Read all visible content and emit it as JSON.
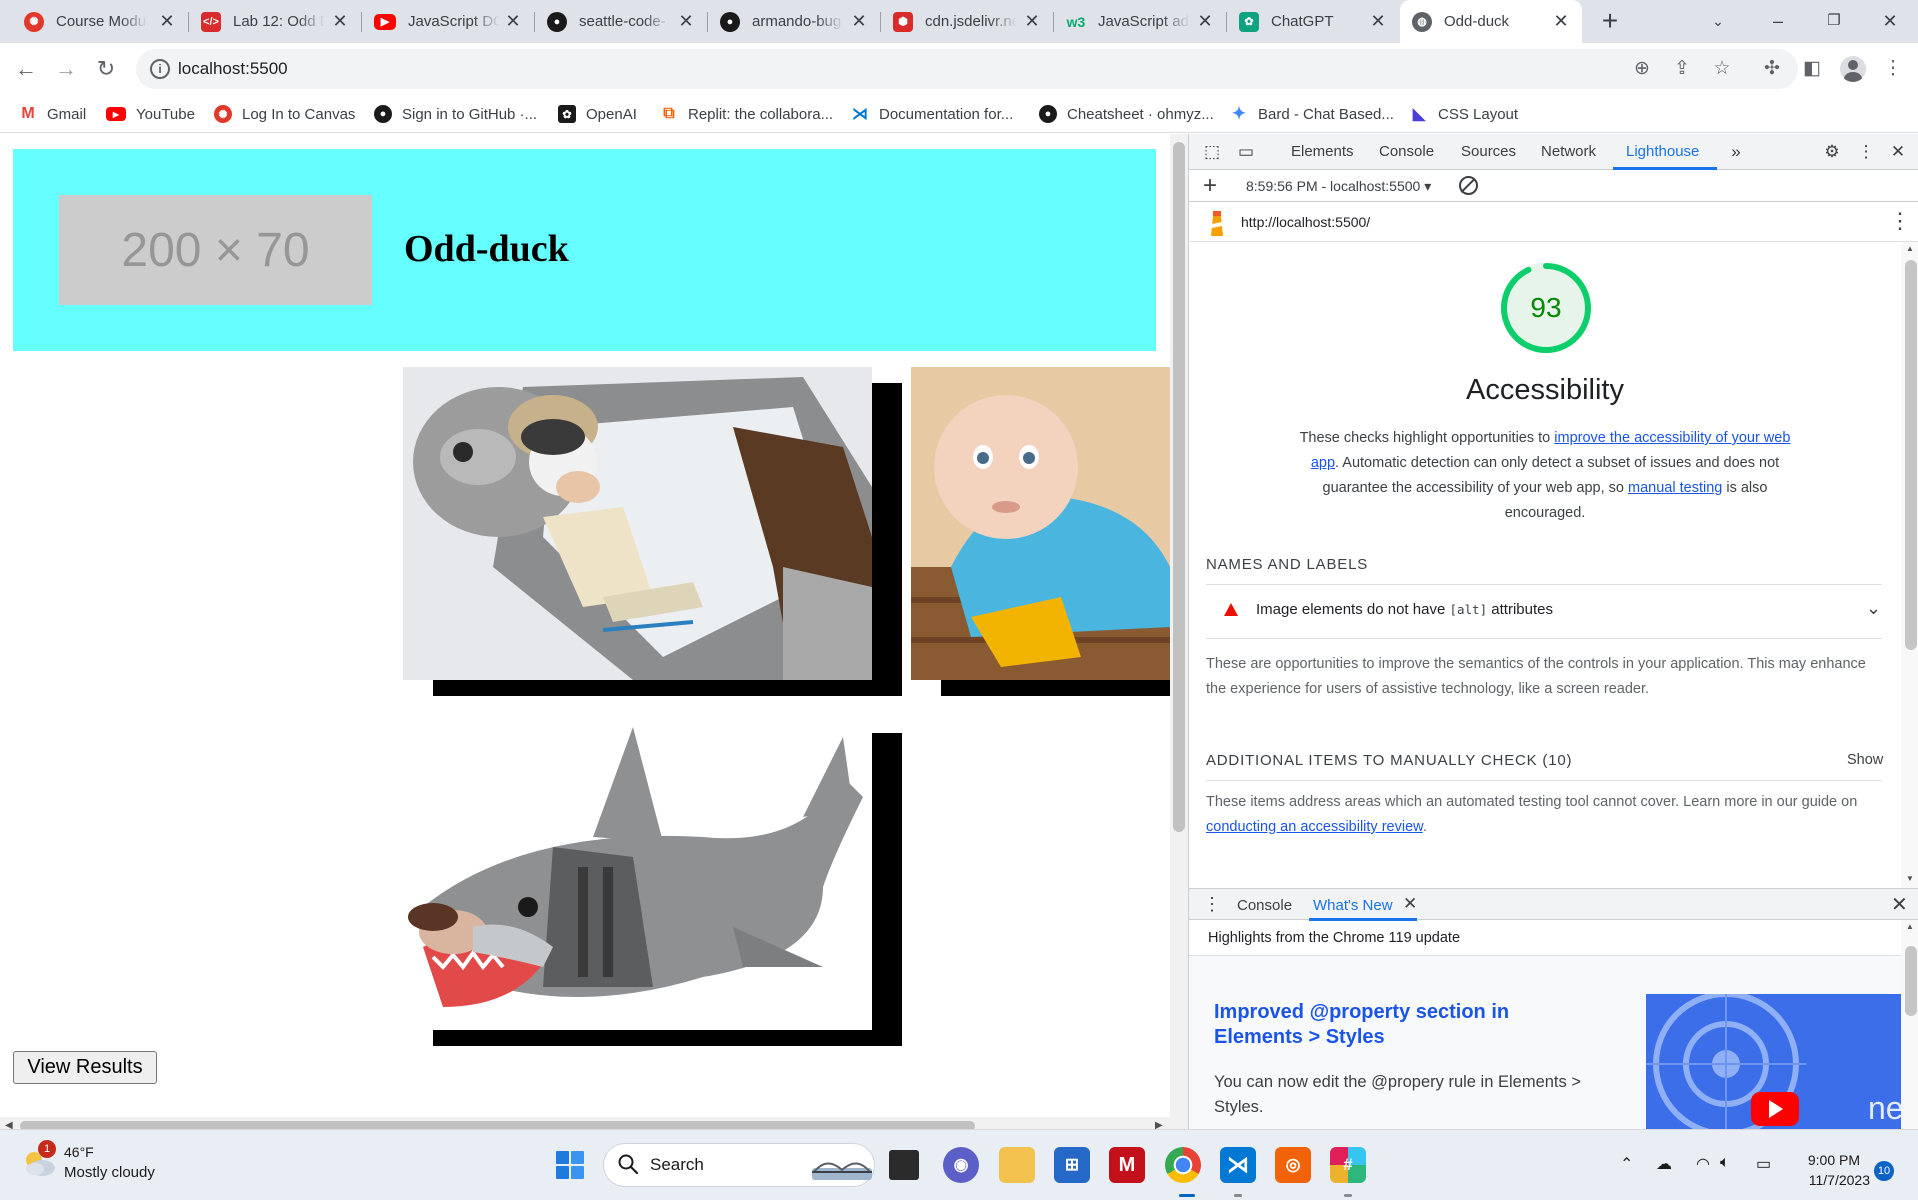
{
  "browser": {
    "tabs": [
      {
        "title": "Course Modu",
        "favicon": "canvas-icon",
        "color": "#e0392b"
      },
      {
        "title": "Lab 12: Odd D",
        "favicon": "codefellows-icon",
        "color": "#d92b2b"
      },
      {
        "title": "JavaScript DO",
        "favicon": "youtube-icon",
        "color": "#ff0000"
      },
      {
        "title": "seattle-code-",
        "favicon": "github-icon",
        "color": "#1a1a1a"
      },
      {
        "title": "armando-bug",
        "favicon": "github-icon",
        "color": "#1a1a1a"
      },
      {
        "title": "cdn.jsdelivr.ne",
        "favicon": "jsdelivr-icon",
        "color": "#d92b2b"
      },
      {
        "title": "JavaScript ad",
        "favicon": "w3schools-icon",
        "color": "#04aa6d"
      },
      {
        "title": "ChatGPT",
        "favicon": "openai-icon",
        "color": "#10a37f"
      },
      {
        "title": "Odd-duck",
        "favicon": "globe-icon",
        "color": "#5f6368"
      }
    ],
    "tab_close_glyph": "✕",
    "new_tab_glyph": "+",
    "url": "localhost:5500",
    "bookmarks": [
      {
        "label": "Gmail",
        "icon": "gmail-icon",
        "color": "#ea4335"
      },
      {
        "label": "YouTube",
        "icon": "youtube-icon",
        "color": "#ff0000"
      },
      {
        "label": "Log In to Canvas",
        "icon": "canvas-icon",
        "color": "#e0392b"
      },
      {
        "label": "Sign in to GitHub ·...",
        "icon": "github-icon",
        "color": "#1a1a1a"
      },
      {
        "label": "OpenAI",
        "icon": "openai-icon",
        "color": "#1a1a1a"
      },
      {
        "label": "Replit: the collabora...",
        "icon": "replit-icon",
        "color": "#f26207"
      },
      {
        "label": "Documentation for...",
        "icon": "vscode-icon",
        "color": "#0078d4"
      },
      {
        "label": "Cheatsheet · ohmyz...",
        "icon": "github-icon",
        "color": "#1a1a1a"
      },
      {
        "label": "Bard - Chat Based...",
        "icon": "bard-icon",
        "color": "#4285f4"
      },
      {
        "label": "CSS Layout",
        "icon": "css-layout-icon",
        "color": "#4b3fd6"
      }
    ]
  },
  "page": {
    "logo_placeholder": "200 × 70",
    "site_title": "Odd-duck",
    "products": [
      {
        "name": "wookie-sleeping-bag-image"
      },
      {
        "name": "baby-sweeper-image"
      },
      {
        "name": "shark-sleeping-bag-image"
      }
    ],
    "view_results_label": "View Results"
  },
  "devtools": {
    "tabs": [
      "Elements",
      "Console",
      "Sources",
      "Network",
      "Lighthouse"
    ],
    "active_tab": "Lighthouse",
    "report_selector": "8:59:56 PM - localhost:5500 ▾",
    "report_url": "http://localhost:5500/",
    "score": 93,
    "category_title": "Accessibility",
    "description": {
      "part1": "These checks highlight opportunities to ",
      "link1": "improve the accessibility of your web app",
      "part2": ". Automatic detection can only detect a subset of issues and does not guarantee the accessibility of your web app, so ",
      "link2": "manual testing",
      "part3": " is also encouraged."
    },
    "names_labels_heading": "NAMES AND LABELS",
    "audit": {
      "pre": "Image elements do not have ",
      "code": "[alt]",
      "post": " attributes"
    },
    "names_labels_note": "These are opportunities to improve the semantics of the controls in your application. This may enhance the experience for users of assistive technology, like a screen reader.",
    "manual_heading": "ADDITIONAL ITEMS TO MANUALLY CHECK (10)",
    "manual_show": "Show",
    "manual_note_pre": "These items address areas which an automated testing tool cannot cover. Learn more in our guide on ",
    "manual_note_link": "conducting an accessibility review",
    "manual_note_post": ".",
    "drawer": {
      "tabs": [
        "Console",
        "What's New"
      ],
      "active_tab": "What's New",
      "highlights": "Highlights from the Chrome 119 update",
      "feature_title": "Improved @property section in Elements > Styles",
      "feature_text": "You can now edit the @propery rule in Elements > Styles.",
      "thumb_text": "ne"
    }
  },
  "taskbar": {
    "weather_temp": "46°F",
    "weather_condition": "Mostly cloudy",
    "weather_badge": "1",
    "search_label": "Search",
    "time": "9:00 PM",
    "date": "11/7/2023",
    "notification_count": "10"
  }
}
